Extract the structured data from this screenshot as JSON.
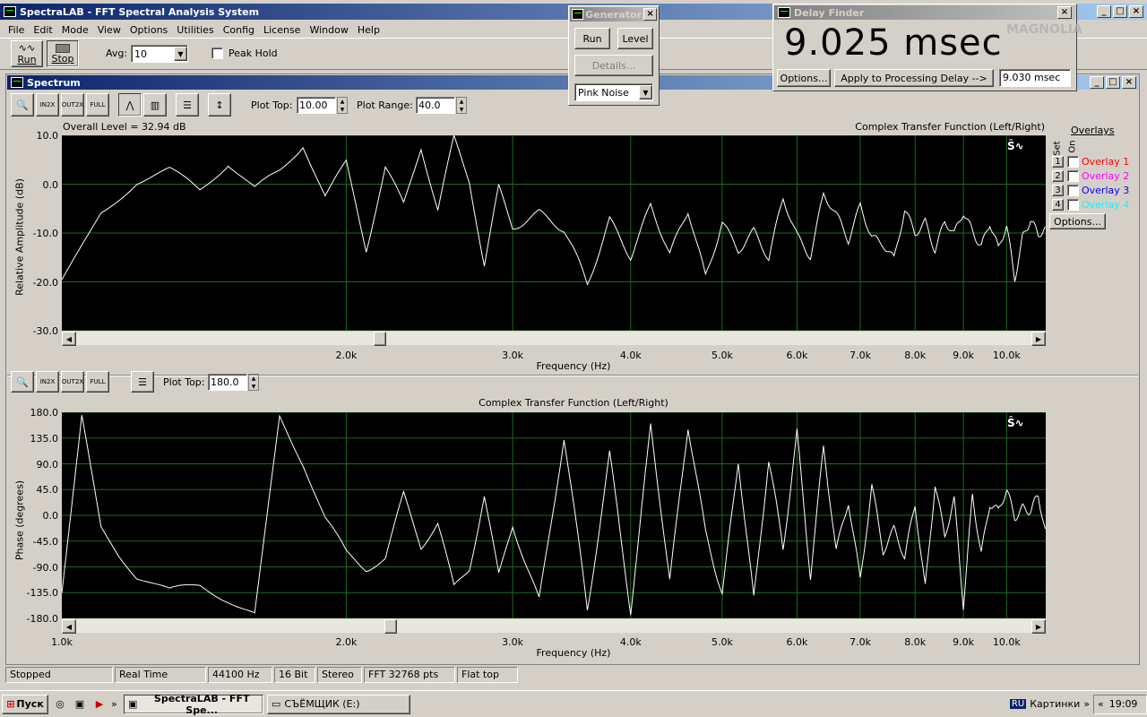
{
  "app": {
    "title": "SpectraLAB - FFT Spectral Analysis System"
  },
  "menu": [
    "File",
    "Edit",
    "Mode",
    "View",
    "Options",
    "Utilities",
    "Config",
    "License",
    "Window",
    "Help"
  ],
  "toolbar": {
    "run": "Run",
    "stop": "Stop",
    "avg_label": "Avg:",
    "avg_value": "10",
    "peak_hold": "Peak Hold"
  },
  "generator": {
    "title": "Generator",
    "run": "Run",
    "level": "Level",
    "details": "Details...",
    "signal": "Pink Noise"
  },
  "delay_finder": {
    "title": "Delay Finder",
    "value": "9.025 msec",
    "options": "Options...",
    "apply": "Apply to Processing Delay -->",
    "processing_delay": "9.030 msec",
    "watermark": "MAGNOLIA"
  },
  "spectrum": {
    "title": "Spectrum",
    "plot_top_label": "Plot Top:",
    "plot_top_value": "10.00",
    "plot_range_label": "Plot Range:",
    "plot_range_value": "40.0",
    "overall_level": "Overall Level = 32.94 dB",
    "title_top": "Complex Transfer Function (Left/Right)",
    "ylabel_top": "Relative Amplitude (dB)",
    "yticks_top": [
      "10.0",
      "0.0",
      "-10.0",
      "-20.0",
      "-30.0"
    ],
    "xticks": [
      "2.0k",
      "3.0k",
      "4.0k",
      "5.0k",
      "6.0k",
      "7.0k",
      "8.0k",
      "9.0k",
      "10.0k"
    ],
    "xticks_bottom": [
      "1.0k",
      "2.0k",
      "3.0k",
      "4.0k",
      "5.0k",
      "6.0k",
      "7.0k",
      "8.0k",
      "9.0k",
      "10.0k"
    ],
    "xlabel": "Frequency (Hz)",
    "overlays_label": "Overlays",
    "set_label": "Set",
    "on_label": "On",
    "overlays": [
      {
        "num": "1",
        "name": "Overlay 1",
        "color": "#ff0000"
      },
      {
        "num": "2",
        "name": "Overlay 2",
        "color": "#ff00ff"
      },
      {
        "num": "3",
        "name": "Overlay 3",
        "color": "#0000ff"
      },
      {
        "num": "4",
        "name": "Overlay 4",
        "color": "#00ffff"
      }
    ],
    "options": "Options...",
    "plot_top2_label": "Plot Top:",
    "plot_top2_value": "180.0",
    "title_bottom": "Complex Transfer Function (Left/Right)",
    "ylabel_bottom": "Phase (degrees)",
    "yticks_bottom": [
      "180.0",
      "135.0",
      "90.0",
      "45.0",
      "0.0",
      "-45.0",
      "-90.0",
      "-135.0",
      "-180.0"
    ]
  },
  "status": [
    "Stopped",
    "Real Time",
    "44100 Hz",
    "16 Bit",
    "Stereo",
    "FFT 32768 pts",
    "Flat top"
  ],
  "taskbar": {
    "start": "Пуск",
    "task1": "SpectraLAB - FFT Spe...",
    "task2": "СЪЁМЩИК (E:)",
    "lang": "RU",
    "tray_label": "Картинки",
    "clock": "19:09"
  },
  "chart_data": [
    {
      "type": "line",
      "title": "Complex Transfer Function (Left/Right)",
      "xlabel": "Frequency (Hz)",
      "ylabel": "Relative Amplitude (dB)",
      "ylim": [
        -30,
        10
      ],
      "xlim": [
        1000,
        11000
      ],
      "grid": true,
      "series": [
        {
          "x": [
            1000,
            1100,
            1200,
            1300,
            1400,
            1500,
            1600,
            1700,
            1800,
            1900,
            2000,
            2100,
            2200,
            2300,
            2400,
            2500,
            2600,
            2700,
            2800,
            2900,
            3000,
            3200,
            3400,
            3600,
            3800,
            4000,
            4200,
            4400,
            4600,
            4800,
            5000,
            5200,
            5400,
            5600,
            5800,
            6000,
            6200,
            6400,
            6600,
            6800,
            7000,
            7200,
            7400,
            7600,
            7800,
            8000,
            8200,
            8400,
            8600,
            8800,
            9000,
            9200,
            9400,
            9600,
            9800,
            10000,
            10200,
            10400,
            10600,
            10800,
            11000
          ],
          "values": [
            -20,
            -6,
            0,
            2,
            -2,
            4,
            -1,
            3,
            9,
            -2,
            5,
            -13,
            3,
            -5,
            7,
            -6,
            9,
            1,
            -16,
            0,
            -8,
            -6,
            -10,
            -21,
            -7,
            -14,
            -4,
            -15,
            -6,
            -19,
            -7,
            -13,
            -10,
            -16,
            -3,
            -10,
            -14,
            -2,
            -7,
            -12,
            -4,
            -10,
            -12,
            -16,
            -6,
            -10,
            -7,
            -13,
            -8,
            -11,
            -6,
            -9,
            -12,
            -8,
            -14,
            -9,
            -19,
            -10,
            -7,
            -11,
            -10
          ]
        }
      ]
    },
    {
      "type": "line",
      "title": "Complex Transfer Function (Left/Right)",
      "xlabel": "Frequency (Hz)",
      "ylabel": "Phase (degrees)",
      "ylim": [
        -180,
        180
      ],
      "xlim": [
        1000,
        11000
      ],
      "grid": true,
      "series": [
        {
          "x": [
            1000,
            1050,
            1100,
            1150,
            1200,
            1300,
            1400,
            1500,
            1600,
            1700,
            1800,
            1900,
            2000,
            2100,
            2200,
            2300,
            2400,
            2500,
            2600,
            2700,
            2800,
            2900,
            3000,
            3200,
            3400,
            3600,
            3800,
            4000,
            4200,
            4400,
            4600,
            4800,
            5000,
            5200,
            5400,
            5600,
            5800,
            6000,
            6200,
            6400,
            6600,
            6800,
            7000,
            7200,
            7400,
            7600,
            7800,
            8000,
            8200,
            8400,
            8600,
            8800,
            9000,
            9200,
            9400,
            9600,
            9800,
            10000,
            10200,
            10400,
            10600,
            10800,
            11000
          ],
          "values": [
            -140,
            170,
            -20,
            -70,
            -110,
            -140,
            -130,
            -150,
            -175,
            175,
            100,
            0,
            -60,
            -90,
            -80,
            30,
            -60,
            -20,
            -130,
            -90,
            40,
            -100,
            -10,
            -150,
            130,
            -170,
            110,
            -160,
            160,
            -120,
            150,
            -30,
            -130,
            100,
            -150,
            90,
            -60,
            150,
            -100,
            120,
            -70,
            20,
            -110,
            60,
            -60,
            -30,
            -80,
            20,
            -120,
            60,
            -40,
            20,
            -160,
            40,
            -60,
            20,
            0,
            40,
            0,
            20,
            10,
            30,
            -40
          ]
        }
      ]
    }
  ]
}
